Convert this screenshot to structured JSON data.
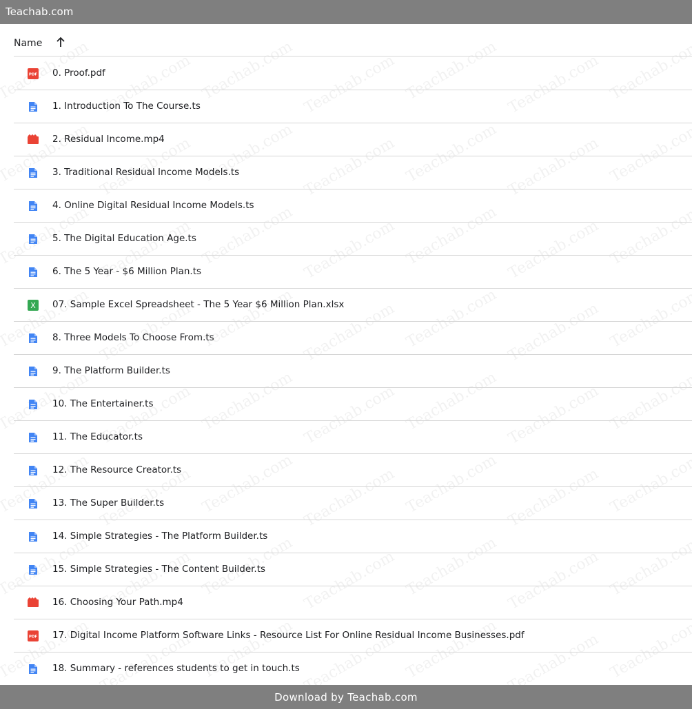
{
  "site_title": "Teachab.com",
  "header": {
    "name_label": "Name",
    "sort_icon": "arrow-up-icon"
  },
  "watermark_text": "Teachab.com",
  "files": [
    {
      "name": "0. Proof.pdf",
      "type": "pdf"
    },
    {
      "name": "1. Introduction To The Course.ts",
      "type": "doc"
    },
    {
      "name": "2. Residual Income.mp4",
      "type": "video"
    },
    {
      "name": "3. Traditional Residual Income Models.ts",
      "type": "doc"
    },
    {
      "name": "4. Online Digital Residual Income Models.ts",
      "type": "doc"
    },
    {
      "name": "5. The Digital Education Age.ts",
      "type": "doc"
    },
    {
      "name": "6. The 5 Year - $6 Million Plan.ts",
      "type": "doc"
    },
    {
      "name": "07. Sample Excel Spreadsheet - The 5 Year $6 Million Plan.xlsx",
      "type": "sheet"
    },
    {
      "name": "8. Three Models To Choose From.ts",
      "type": "doc"
    },
    {
      "name": "9. The Platform Builder.ts",
      "type": "doc"
    },
    {
      "name": "10. The Entertainer.ts",
      "type": "doc"
    },
    {
      "name": "11. The Educator.ts",
      "type": "doc"
    },
    {
      "name": "12. The Resource Creator.ts",
      "type": "doc"
    },
    {
      "name": "13. The Super Builder.ts",
      "type": "doc"
    },
    {
      "name": "14. Simple Strategies - The Platform Builder.ts",
      "type": "doc"
    },
    {
      "name": "15. Simple Strategies - The Content Builder.ts",
      "type": "doc"
    },
    {
      "name": "16. Choosing Your Path.mp4",
      "type": "video"
    },
    {
      "name": "17. Digital Income Platform Software Links - Resource List For Online Residual Income Businesses.pdf",
      "type": "pdf"
    },
    {
      "name": "18. Summary - references students to get in touch.ts",
      "type": "doc"
    }
  ],
  "icon_labels": {
    "pdf": "PDF",
    "sheet": "X"
  },
  "colors": {
    "pdf": "#ea4335",
    "doc": "#4285f4",
    "video": "#ea4335",
    "sheet": "#34a853",
    "bar": "#7f7f7f"
  },
  "footer_text": "Download by Teachab.com"
}
